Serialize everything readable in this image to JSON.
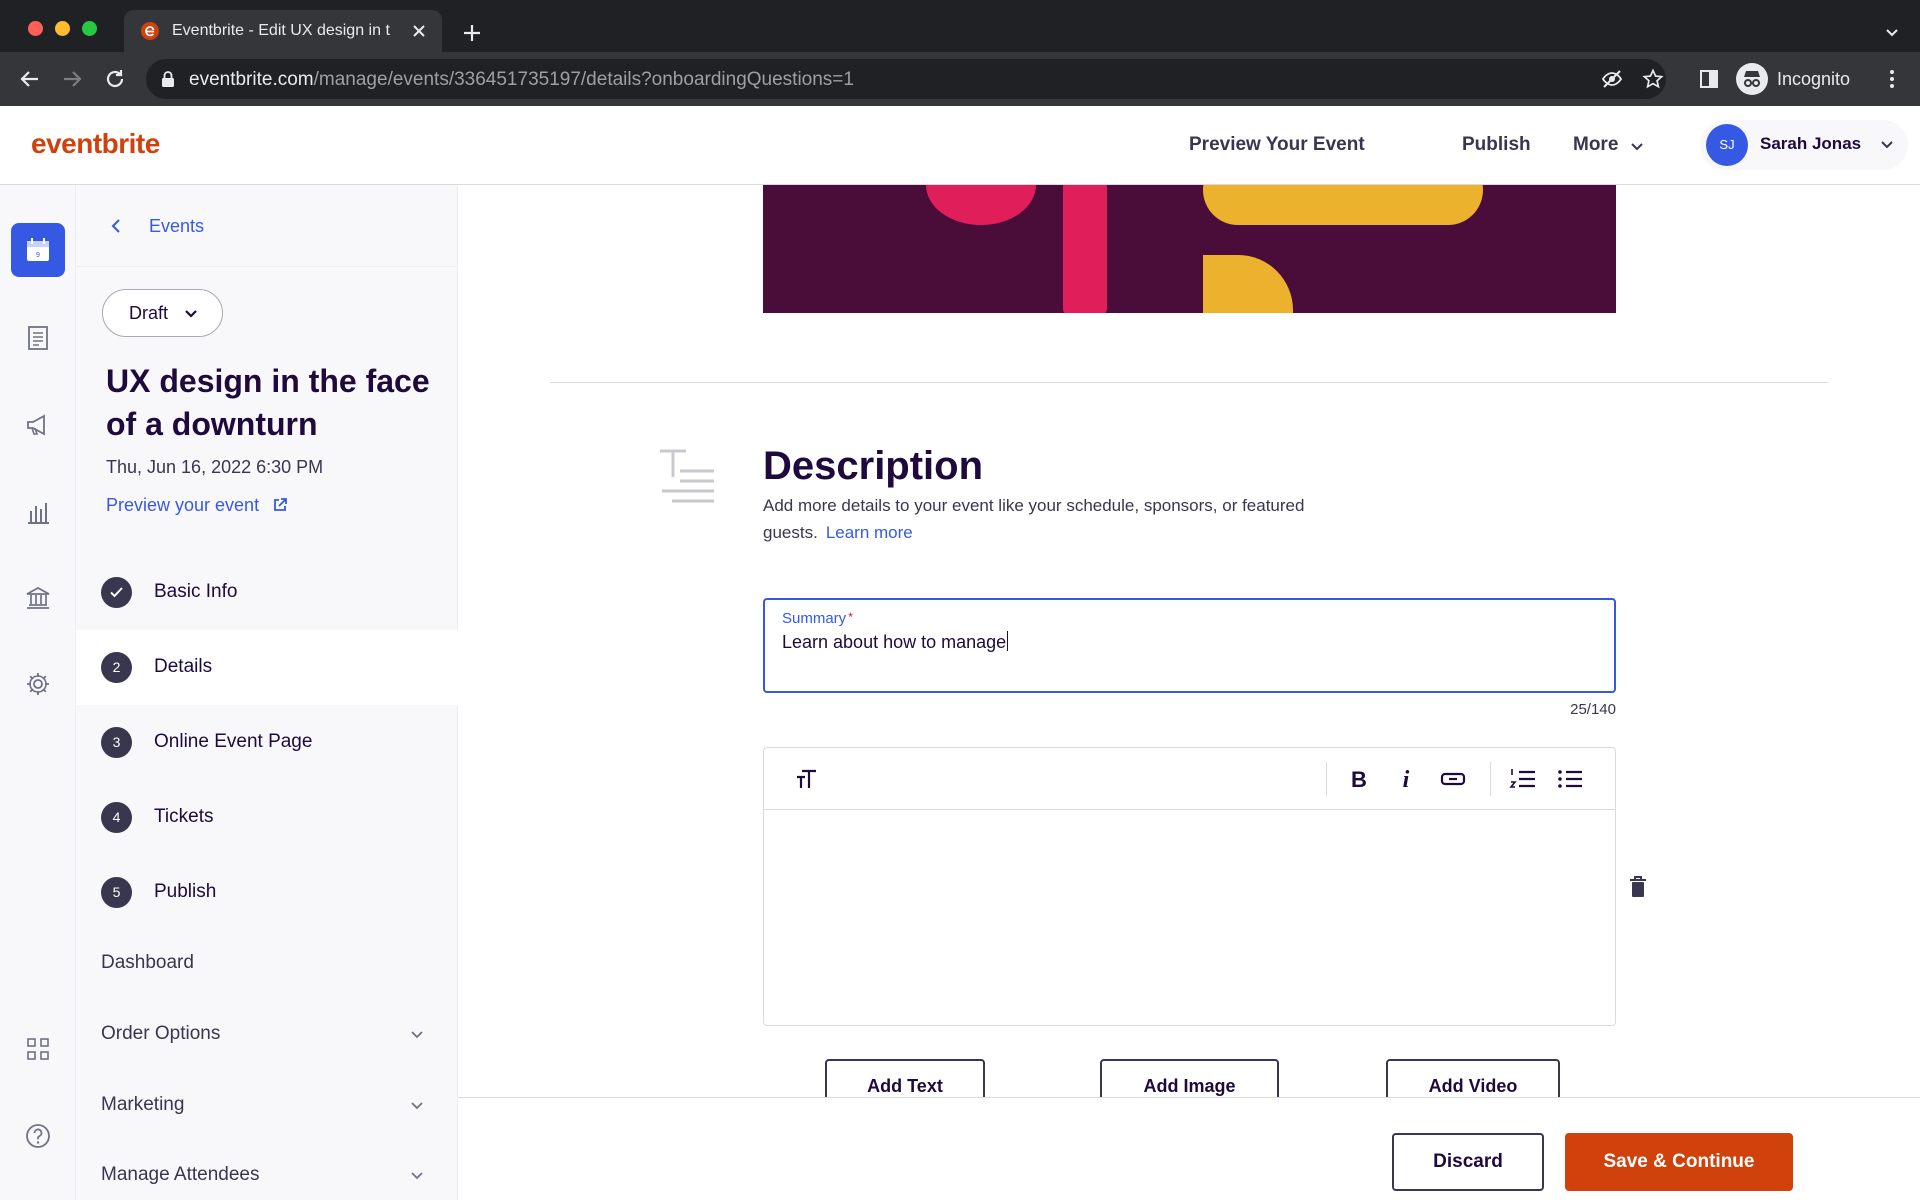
{
  "browser": {
    "tab_title": "Eventbrite - Edit UX design in t",
    "url_host": "eventbrite.com",
    "url_path": "/manage/events/336451735197/details?onboardingQuestions=1",
    "profile_label": "Incognito"
  },
  "header": {
    "logo": "eventbrite",
    "preview_label": "Preview Your Event",
    "publish_label": "Publish",
    "more_label": "More",
    "user_initials": "SJ",
    "user_name": "Sarah Jonas"
  },
  "rail": {
    "icons": [
      "calendar-icon",
      "orders-icon",
      "megaphone-icon",
      "reports-icon",
      "finance-icon",
      "settings-icon",
      "apps-icon",
      "help-icon"
    ]
  },
  "sidebar": {
    "back_label": "Events",
    "status_label": "Draft",
    "event_title": "UX design in the face of a downturn",
    "event_date": "Thu, Jun 16, 2022 6:30 PM",
    "preview_link": "Preview your event",
    "steps": [
      {
        "num": "",
        "label": "Basic Info",
        "state": "done"
      },
      {
        "num": "2",
        "label": "Details",
        "state": "current"
      },
      {
        "num": "3",
        "label": "Online Event Page",
        "state": "todo"
      },
      {
        "num": "4",
        "label": "Tickets",
        "state": "todo"
      },
      {
        "num": "5",
        "label": "Publish",
        "state": "todo"
      }
    ],
    "dashboard_label": "Dashboard",
    "order_options_label": "Order Options",
    "marketing_label": "Marketing",
    "manage_attendees_label": "Manage Attendees"
  },
  "description": {
    "title": "Description",
    "text": "Add more details to your event like your schedule, sponsors, or featured guests.",
    "learn_more": "Learn more",
    "summary_label": "Summary",
    "summary_required": "*",
    "summary_value": "Learn about how to manage",
    "counter": "25/140",
    "add_text": "Add Text",
    "add_image": "Add Image",
    "add_video": "Add Video"
  },
  "footer": {
    "discard_label": "Discard",
    "save_label": "Save & Continue"
  },
  "colors": {
    "brand": "#d1410c",
    "accent": "#3659e3",
    "text_dark": "#1e0a3c"
  }
}
